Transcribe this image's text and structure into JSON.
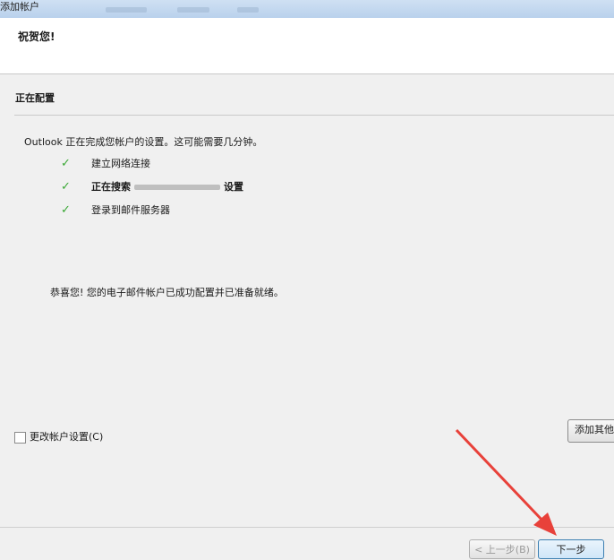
{
  "window": {
    "title": "添加帐户"
  },
  "header": {
    "greeting": "祝贺您!"
  },
  "section": {
    "heading": "正在配置"
  },
  "status": {
    "text": "Outlook 正在完成您帐户的设置。这可能需要几分钟。"
  },
  "steps": [
    {
      "label": "建立网络连接"
    },
    {
      "label_before": "正在搜索",
      "label_after": "设置"
    },
    {
      "label": "登录到邮件服务器"
    }
  ],
  "success": {
    "text": "恭喜您! 您的电子邮件帐户已成功配置并已准备就绪。"
  },
  "change_settings": {
    "label": "更改帐户设置(C)"
  },
  "buttons": {
    "add_other": "添加其他",
    "back": "< 上一步(B)",
    "next": "下一步"
  },
  "colors": {
    "check": "#3aa835",
    "arrow": "#e8413a"
  }
}
